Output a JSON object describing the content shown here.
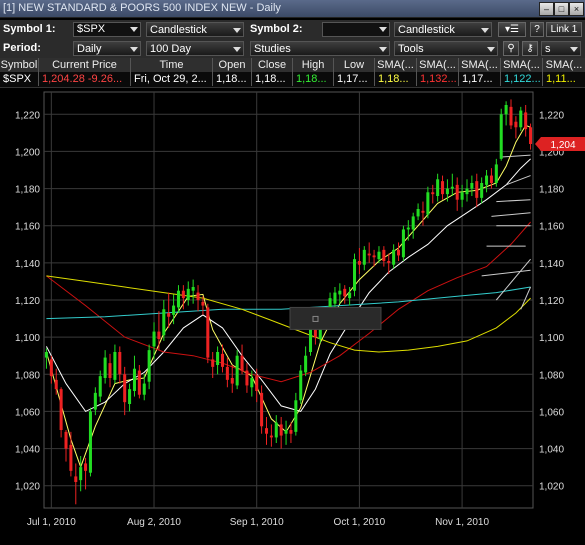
{
  "window": {
    "title": "[1] NEW STANDARD & POORS 500 INDEX NEW - Daily"
  },
  "toolbar1": {
    "symbol1_label": "Symbol 1:",
    "symbol1_value": "$SPX",
    "chart_style": "Candlestick",
    "symbol2_label": "Symbol 2:",
    "symbol2_value": "",
    "chart_style2": "Candlestick",
    "help_label": "?",
    "link_label": "Link 1"
  },
  "toolbar2": {
    "period_label": "Period:",
    "period_value": "Daily",
    "range_value": "100 Day",
    "studies_value": "Studies",
    "tools_value": "Tools",
    "s_value": "s"
  },
  "quote": {
    "headers": [
      "Symbol",
      "Current Price",
      "Time",
      "Open",
      "Close",
      "High",
      "Low",
      "SMA(...",
      "SMA(...",
      "SMA(...",
      "SMA(...",
      "SMA(..."
    ],
    "symbol": "$SPX",
    "price": "1,204.28",
    "change": "-9.26...",
    "time": "Fri, Oct 29, 2...",
    "open": "1,18...",
    "close": "1,18...",
    "high": "1,18...",
    "low": "1,17...",
    "sma1": "1,18...",
    "sma2": "1,132...",
    "sma3": "1,17...",
    "sma4": "1,122...",
    "sma5": "1,11..."
  },
  "colors": {
    "up": "#22dd22",
    "down": "#ee2222",
    "grid": "#3a3a3a",
    "sma_fast": "#ffff66",
    "sma_mid": "#ffffff",
    "sma_red": "#cc1111",
    "sma_cyan": "#33cccc",
    "sma_yellow_slow": "#dddd00",
    "price_tag": "#dd2222"
  },
  "chart_data": {
    "type": "candlestick",
    "ylim": [
      1008,
      1232
    ],
    "yticks": [
      1020,
      1040,
      1060,
      1080,
      1100,
      1120,
      1140,
      1160,
      1180,
      1200,
      1220
    ],
    "xticks": [
      {
        "label": "Jul 1, 2010",
        "index": 1
      },
      {
        "label": "Aug 2, 2010",
        "index": 22
      },
      {
        "label": "Sep 1, 2010",
        "index": 43
      },
      {
        "label": "Oct 1, 2010",
        "index": 64
      },
      {
        "label": "Nov 1, 2010",
        "index": 85
      }
    ],
    "last_price_label": "1,204",
    "last_price": 1204,
    "candles": [
      [
        1089,
        1092,
        1094,
        1083
      ],
      [
        1088,
        1079,
        1090,
        1075
      ],
      [
        1077,
        1072,
        1083,
        1069
      ],
      [
        1072,
        1050,
        1073,
        1046
      ],
      [
        1049,
        1040,
        1050,
        1033
      ],
      [
        1042,
        1028,
        1049,
        1025
      ],
      [
        1025,
        1022,
        1032,
        1010
      ],
      [
        1023,
        1030,
        1036,
        1017
      ],
      [
        1032,
        1028,
        1035,
        1018
      ],
      [
        1027,
        1060,
        1062,
        1025
      ],
      [
        1061,
        1070,
        1073,
        1058
      ],
      [
        1068,
        1079,
        1082,
        1065
      ],
      [
        1078,
        1089,
        1093,
        1075
      ],
      [
        1086,
        1078,
        1091,
        1073
      ],
      [
        1077,
        1092,
        1096,
        1075
      ],
      [
        1092,
        1080,
        1095,
        1075
      ],
      [
        1080,
        1065,
        1084,
        1058
      ],
      [
        1064,
        1072,
        1075,
        1060
      ],
      [
        1071,
        1083,
        1090,
        1068
      ],
      [
        1082,
        1069,
        1085,
        1067
      ],
      [
        1069,
        1075,
        1080,
        1066
      ],
      [
        1076,
        1093,
        1096,
        1072
      ],
      [
        1095,
        1103,
        1108,
        1088
      ],
      [
        1103,
        1099,
        1114,
        1093
      ],
      [
        1101,
        1115,
        1120,
        1098
      ],
      [
        1113,
        1111,
        1124,
        1105
      ],
      [
        1112,
        1117,
        1123,
        1107
      ],
      [
        1116,
        1125,
        1128,
        1113
      ],
      [
        1125,
        1121,
        1128,
        1115
      ],
      [
        1120,
        1126,
        1130,
        1117
      ],
      [
        1125,
        1127,
        1131,
        1118
      ],
      [
        1124,
        1120,
        1128,
        1114
      ],
      [
        1119,
        1117,
        1122,
        1112
      ],
      [
        1116,
        1089,
        1118,
        1086
      ],
      [
        1088,
        1084,
        1092,
        1078
      ],
      [
        1085,
        1092,
        1095,
        1080
      ],
      [
        1091,
        1084,
        1096,
        1081
      ],
      [
        1084,
        1077,
        1089,
        1073
      ],
      [
        1078,
        1075,
        1085,
        1070
      ],
      [
        1074,
        1090,
        1093,
        1072
      ],
      [
        1090,
        1082,
        1096,
        1080
      ],
      [
        1082,
        1074,
        1086,
        1070
      ],
      [
        1073,
        1078,
        1082,
        1068
      ],
      [
        1079,
        1071,
        1083,
        1065
      ],
      [
        1070,
        1052,
        1074,
        1048
      ],
      [
        1051,
        1048,
        1057,
        1042
      ],
      [
        1047,
        1046,
        1053,
        1041
      ],
      [
        1046,
        1054,
        1058,
        1043
      ],
      [
        1053,
        1047,
        1057,
        1040
      ],
      [
        1048,
        1050,
        1055,
        1042
      ],
      [
        1050,
        1048,
        1054,
        1043
      ],
      [
        1049,
        1066,
        1070,
        1047
      ],
      [
        1066,
        1082,
        1085,
        1064
      ],
      [
        1081,
        1090,
        1095,
        1079
      ],
      [
        1092,
        1105,
        1107,
        1090
      ],
      [
        1104,
        1100,
        1109,
        1096
      ],
      [
        1099,
        1110,
        1112,
        1097
      ],
      [
        1108,
        1109,
        1114,
        1104
      ],
      [
        1108,
        1121,
        1124,
        1106
      ],
      [
        1118,
        1124,
        1127,
        1114
      ],
      [
        1123,
        1125,
        1129,
        1118
      ],
      [
        1126,
        1122,
        1128,
        1118
      ],
      [
        1121,
        1124,
        1127,
        1117
      ],
      [
        1125,
        1142,
        1145,
        1122
      ],
      [
        1141,
        1139,
        1148,
        1134
      ],
      [
        1139,
        1147,
        1149,
        1136
      ],
      [
        1145,
        1144,
        1151,
        1140
      ],
      [
        1144,
        1143,
        1147,
        1138
      ],
      [
        1142,
        1146,
        1149,
        1140
      ],
      [
        1147,
        1141,
        1149,
        1138
      ],
      [
        1141,
        1140,
        1145,
        1134
      ],
      [
        1139,
        1147,
        1150,
        1137
      ],
      [
        1147,
        1144,
        1151,
        1141
      ],
      [
        1143,
        1158,
        1160,
        1141
      ],
      [
        1158,
        1159,
        1163,
        1152
      ],
      [
        1158,
        1165,
        1167,
        1153
      ],
      [
        1165,
        1169,
        1172,
        1163
      ],
      [
        1168,
        1167,
        1173,
        1160
      ],
      [
        1166,
        1178,
        1181,
        1164
      ],
      [
        1178,
        1177,
        1182,
        1172
      ],
      [
        1176,
        1185,
        1188,
        1173
      ],
      [
        1184,
        1177,
        1187,
        1174
      ],
      [
        1177,
        1180,
        1185,
        1173
      ],
      [
        1180,
        1181,
        1188,
        1176
      ],
      [
        1182,
        1174,
        1186,
        1168
      ],
      [
        1174,
        1178,
        1182,
        1170
      ],
      [
        1177,
        1180,
        1185,
        1173
      ],
      [
        1180,
        1183,
        1187,
        1176
      ],
      [
        1184,
        1175,
        1188,
        1170
      ],
      [
        1175,
        1183,
        1186,
        1172
      ],
      [
        1182,
        1187,
        1190,
        1178
      ],
      [
        1187,
        1183,
        1191,
        1180
      ],
      [
        1183,
        1193,
        1196,
        1181
      ],
      [
        1196,
        1220,
        1223,
        1195
      ],
      [
        1220,
        1225,
        1227,
        1214
      ],
      [
        1224,
        1214,
        1228,
        1212
      ],
      [
        1216,
        1213,
        1219,
        1207
      ],
      [
        1213,
        1222,
        1224,
        1211
      ],
      [
        1221,
        1212,
        1225,
        1208
      ],
      [
        1213,
        1204,
        1215,
        1201
      ]
    ],
    "moving_averages": [
      {
        "color": "#ffff66",
        "points": [
          [
            0,
            1092
          ],
          [
            5,
            1045
          ],
          [
            7,
            1030
          ],
          [
            10,
            1052
          ],
          [
            14,
            1075
          ],
          [
            17,
            1077
          ],
          [
            20,
            1078
          ],
          [
            24,
            1102
          ],
          [
            29,
            1122
          ],
          [
            32,
            1123
          ],
          [
            34,
            1104
          ],
          [
            38,
            1085
          ],
          [
            42,
            1079
          ],
          [
            46,
            1056
          ],
          [
            49,
            1049
          ],
          [
            52,
            1062
          ],
          [
            56,
            1097
          ],
          [
            60,
            1118
          ],
          [
            64,
            1131
          ],
          [
            68,
            1141
          ],
          [
            72,
            1148
          ],
          [
            76,
            1160
          ],
          [
            80,
            1172
          ],
          [
            84,
            1178
          ],
          [
            88,
            1179
          ],
          [
            92,
            1183
          ],
          [
            94,
            1192
          ],
          [
            96,
            1205
          ],
          [
            98,
            1214
          ],
          [
            99,
            1213
          ]
        ]
      },
      {
        "color": "#ffffff",
        "points": [
          [
            0,
            1095
          ],
          [
            4,
            1075
          ],
          [
            8,
            1060
          ],
          [
            12,
            1065
          ],
          [
            16,
            1075
          ],
          [
            20,
            1081
          ],
          [
            24,
            1092
          ],
          [
            28,
            1105
          ],
          [
            32,
            1112
          ],
          [
            36,
            1105
          ],
          [
            40,
            1090
          ],
          [
            44,
            1077
          ],
          [
            48,
            1063
          ],
          [
            52,
            1060
          ],
          [
            55,
            1072
          ],
          [
            58,
            1091
          ],
          [
            62,
            1108
          ],
          [
            66,
            1124
          ],
          [
            70,
            1135
          ],
          [
            74,
            1143
          ],
          [
            78,
            1150
          ],
          [
            82,
            1160
          ],
          [
            86,
            1167
          ],
          [
            90,
            1174
          ],
          [
            94,
            1182
          ],
          [
            97,
            1191
          ],
          [
            99,
            1196
          ]
        ]
      },
      {
        "color": "#cc1111",
        "points": [
          [
            0,
            1133
          ],
          [
            8,
            1117
          ],
          [
            16,
            1100
          ],
          [
            24,
            1092
          ],
          [
            30,
            1090
          ],
          [
            36,
            1086
          ],
          [
            42,
            1080
          ],
          [
            48,
            1076
          ],
          [
            54,
            1081
          ],
          [
            60,
            1090
          ],
          [
            66,
            1102
          ],
          [
            72,
            1115
          ],
          [
            78,
            1125
          ],
          [
            84,
            1132
          ],
          [
            90,
            1138
          ],
          [
            95,
            1150
          ],
          [
            99,
            1162
          ]
        ]
      },
      {
        "color": "#33cccc",
        "points": [
          [
            0,
            1110
          ],
          [
            12,
            1111
          ],
          [
            24,
            1113
          ],
          [
            36,
            1115
          ],
          [
            48,
            1115
          ],
          [
            60,
            1117
          ],
          [
            72,
            1119
          ],
          [
            84,
            1122
          ],
          [
            92,
            1124
          ],
          [
            99,
            1127
          ]
        ]
      },
      {
        "color": "#dddd00",
        "points": [
          [
            0,
            1133
          ],
          [
            8,
            1130
          ],
          [
            16,
            1127
          ],
          [
            24,
            1124
          ],
          [
            32,
            1121
          ],
          [
            40,
            1115
          ],
          [
            46,
            1109
          ],
          [
            52,
            1103
          ],
          [
            58,
            1097
          ],
          [
            63,
            1093
          ],
          [
            68,
            1092
          ],
          [
            74,
            1093
          ],
          [
            80,
            1095
          ],
          [
            86,
            1098
          ],
          [
            92,
            1105
          ],
          [
            96,
            1113
          ],
          [
            99,
            1121
          ]
        ]
      }
    ],
    "trend_lines": [
      [
        [
          93,
          1197
        ],
        [
          99,
          1198
        ]
      ],
      [
        [
          94,
          1182
        ],
        [
          99,
          1187
        ]
      ],
      [
        [
          92,
          1173
        ],
        [
          99,
          1174
        ]
      ],
      [
        [
          91,
          1165
        ],
        [
          99,
          1167
        ]
      ],
      [
        [
          92,
          1160
        ],
        [
          99,
          1160
        ]
      ],
      [
        [
          90,
          1149
        ],
        [
          98,
          1149
        ]
      ],
      [
        [
          89,
          1133
        ],
        [
          99,
          1136
        ]
      ],
      [
        [
          92,
          1120
        ],
        [
          99,
          1142
        ]
      ],
      [
        [
          97,
          1115
        ],
        [
          99,
          1127
        ]
      ]
    ]
  }
}
